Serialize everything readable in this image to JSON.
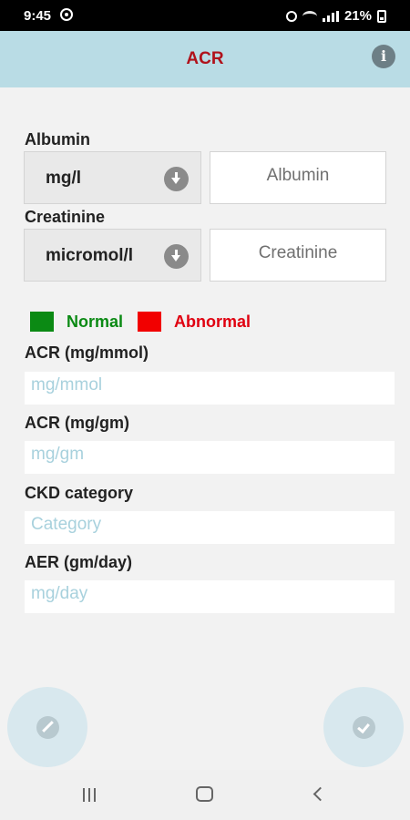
{
  "status_bar": {
    "time": "9:45",
    "battery": "21%"
  },
  "app_bar": {
    "title": "ACR"
  },
  "albumin": {
    "label": "Albumin",
    "unit": "mg/l",
    "placeholder": "Albumin"
  },
  "creatinine": {
    "label": "Creatinine",
    "unit": "micromol/l",
    "placeholder": "Creatinine"
  },
  "legend": {
    "normal_label": "Normal",
    "normal_color": "#0b8a14",
    "abnormal_label": "Abnormal",
    "abnormal_color": "#f20000"
  },
  "results": [
    {
      "label": "ACR (mg/mmol)",
      "placeholder": "mg/mmol"
    },
    {
      "label": "ACR (mg/gm)",
      "placeholder": "mg/gm"
    },
    {
      "label": "CKD category",
      "placeholder": "Category"
    },
    {
      "label": "AER (gm/day)",
      "placeholder": "mg/day"
    }
  ],
  "colors": {
    "app_bar_bg": "#b9dce5",
    "title_color": "#b0121b",
    "fab_bg": "#d8e8ee"
  },
  "icons": {
    "info": "info-icon",
    "dropdown": "arrow-down-circle-icon",
    "edit": "pencil-icon",
    "confirm": "check-icon"
  }
}
